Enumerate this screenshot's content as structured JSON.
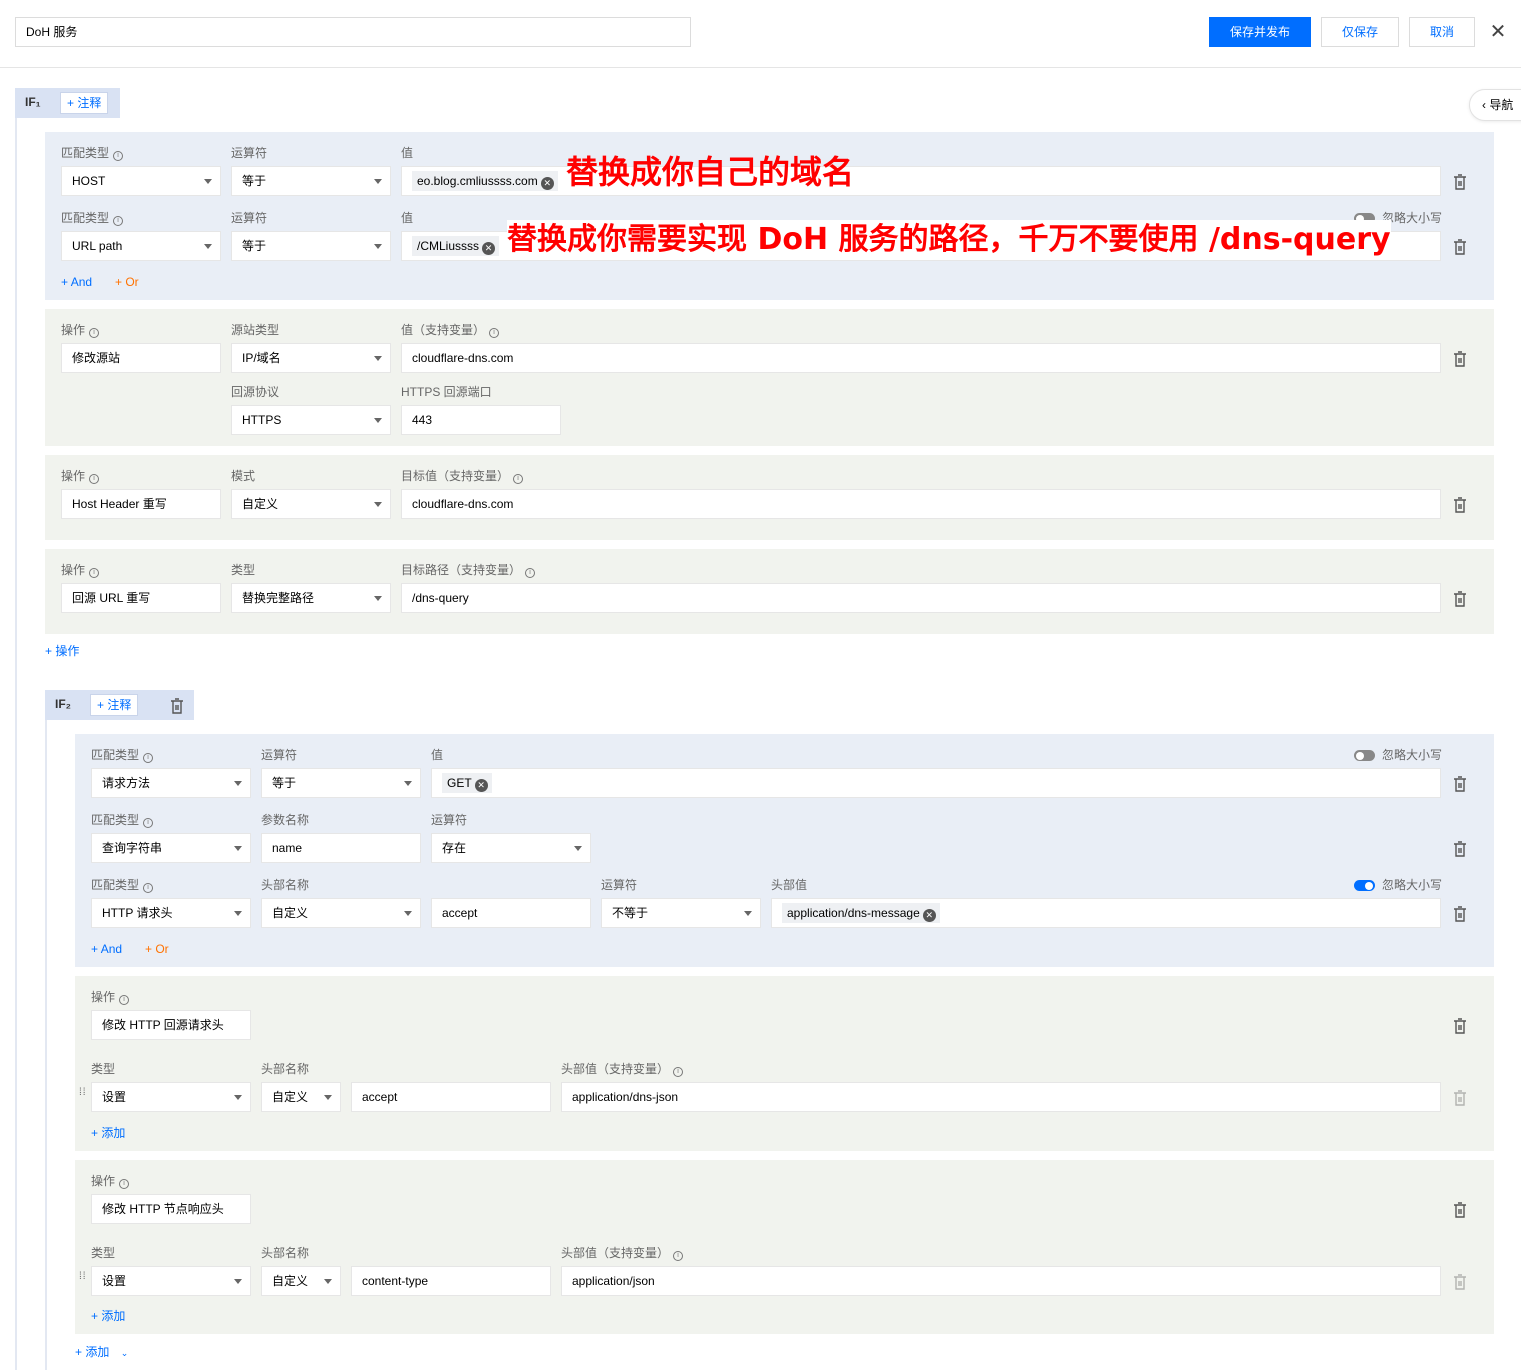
{
  "header": {
    "rule_name": "DoH 服务",
    "save_publish": "保存并发布",
    "save_only": "仅保存",
    "cancel": "取消",
    "close": "✕"
  },
  "nav": {
    "label": "导航"
  },
  "if1": {
    "tag": "IF₁",
    "note": "注释",
    "cond": {
      "row1": {
        "match_label": "匹配类型",
        "op_label": "运算符",
        "val_label": "值",
        "match": "HOST",
        "op": "等于",
        "chip": "eo.blog.cmliussss.com"
      },
      "row2": {
        "match_label": "匹配类型",
        "op_label": "运算符",
        "val_label": "值",
        "match": "URL path",
        "op": "等于",
        "chip": "/CMLiussss",
        "ignore_case": "忽略大小写"
      },
      "and": "And",
      "or": "Or"
    },
    "act1": {
      "op_label": "操作",
      "src_label": "源站类型",
      "val_label": "值（支持变量）",
      "op": "修改源站",
      "src": "IP/域名",
      "val": "cloudflare-dns.com",
      "proto_label": "回源协议",
      "port_label": "HTTPS 回源端口",
      "proto": "HTTPS",
      "port": "443"
    },
    "act2": {
      "op_label": "操作",
      "mode_label": "模式",
      "target_label": "目标值（支持变量）",
      "op": "Host Header 重写",
      "mode": "自定义",
      "target": "cloudflare-dns.com"
    },
    "act3": {
      "op_label": "操作",
      "type_label": "类型",
      "path_label": "目标路径（支持变量）",
      "op": "回源 URL 重写",
      "type": "替换完整路径",
      "path": "/dns-query"
    },
    "add_action": "操作"
  },
  "annotations": {
    "note1": "替换成你自己的域名",
    "note2": "替换成你需要实现 DoH 服务的路径，千万不要使用 /dns-query"
  },
  "if2": {
    "tag": "IF₂",
    "note": "注释",
    "cond": {
      "row1": {
        "match_label": "匹配类型",
        "op_label": "运算符",
        "val_label": "值",
        "match": "请求方法",
        "op": "等于",
        "chip": "GET",
        "ignore_case": "忽略大小写"
      },
      "row2": {
        "match_label": "匹配类型",
        "param_label": "参数名称",
        "op_label": "运算符",
        "match": "查询字符串",
        "param": "name",
        "op": "存在"
      },
      "row3": {
        "match_label": "匹配类型",
        "hname_label": "头部名称",
        "op_label": "运算符",
        "hval_label": "头部值",
        "match": "HTTP 请求头",
        "hmode": "自定义",
        "hname": "accept",
        "op": "不等于",
        "chip": "application/dns-message",
        "ignore_case": "忽略大小写"
      },
      "and": "And",
      "or": "Or"
    },
    "act1": {
      "op_label": "操作",
      "op": "修改 HTTP 回源请求头",
      "type_label": "类型",
      "hname_label": "头部名称",
      "hval_label": "头部值（支持变量）",
      "type": "设置",
      "hmode": "自定义",
      "hname": "accept",
      "hval": "application/dns-json",
      "add": "添加"
    },
    "act2": {
      "op_label": "操作",
      "op": "修改 HTTP 节点响应头",
      "type_label": "类型",
      "hname_label": "头部名称",
      "hval_label": "头部值（支持变量）",
      "type": "设置",
      "hmode": "自定义",
      "hname": "content-type",
      "hval": "application/json",
      "add": "添加"
    },
    "add_more": "添加"
  }
}
